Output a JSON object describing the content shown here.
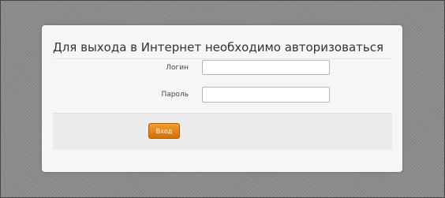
{
  "login_form": {
    "title": "Для выхода в Интернет необходимо авторизоваться",
    "login_label": "Логин",
    "login_value": "",
    "password_label": "Пароль",
    "password_value": "",
    "submit_label": "Вход"
  },
  "colors": {
    "button": "#e07f10",
    "panel": "#f6f6f6",
    "background": "#8c8c8c"
  }
}
